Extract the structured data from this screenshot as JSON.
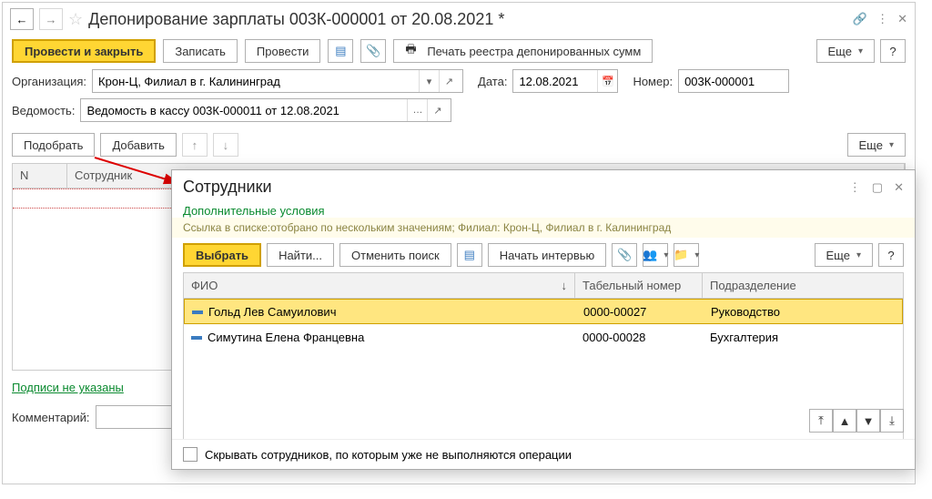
{
  "main": {
    "title": "Депонирование зарплаты 003К-000001 от 20.08.2021 *",
    "toolbar": {
      "post_close": "Провести и закрыть",
      "write": "Записать",
      "post": "Провести",
      "print_registry": "Печать реестра депонированных сумм",
      "more": "Еще",
      "help": "?"
    },
    "fields": {
      "org_label": "Организация:",
      "org_value": "Крон-Ц, Филиал в г. Калининград",
      "date_label": "Дата:",
      "date_value": "12.08.2021",
      "num_label": "Номер:",
      "num_value": "003К-000001",
      "stmt_label": "Ведомость:",
      "stmt_value": "Ведомость в кассу 003К-000011 от 12.08.2021"
    },
    "table_toolbar": {
      "select": "Подобрать",
      "add": "Добавить",
      "more": "Еще"
    },
    "table": {
      "col_n": "N",
      "col_emp": "Сотрудник"
    },
    "footer": {
      "signatures": "Подписи не указаны",
      "comment_label": "Комментарий:"
    }
  },
  "popup": {
    "title": "Сотрудники",
    "conditions": "Дополнительные условия",
    "filter_text": "Ссылка в списке:отобрано по нескольким значениям; Филиал: Крон-Ц, Филиал в г. Калининград",
    "toolbar": {
      "choose": "Выбрать",
      "find": "Найти...",
      "cancel_find": "Отменить поиск",
      "interview": "Начать интервью",
      "more": "Еще",
      "help": "?"
    },
    "columns": {
      "fio": "ФИО",
      "tab": "Табельный номер",
      "dept": "Подразделение"
    },
    "rows": [
      {
        "fio": "Гольд Лев Самуилович",
        "tab": "0000-00027",
        "dept": "Руководство"
      },
      {
        "fio": "Симутина Елена Францевна",
        "tab": "0000-00028",
        "dept": "Бухгалтерия"
      }
    ],
    "hide_label": "Скрывать сотрудников, по которым уже не выполняются операции"
  }
}
